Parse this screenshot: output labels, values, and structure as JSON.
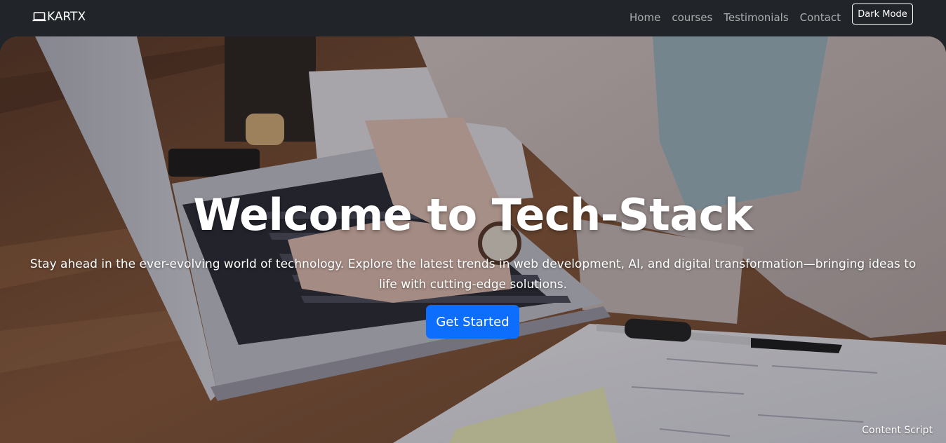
{
  "navbar": {
    "brand": "KARTX",
    "brand_icon": "laptop-icon",
    "links": [
      "Home",
      "courses",
      "Testimonials",
      "Contact"
    ],
    "dark_mode_label": "Dark Mode"
  },
  "hero": {
    "title": "Welcome to Tech-Stack",
    "subtitle": "Stay ahead in the ever-evolving world of technology. Explore the latest trends in web development, AI, and digital transformation—bringing ideas to life with cutting-edge solutions.",
    "cta_label": "Get Started",
    "background_image": "laptop-typing-photo"
  },
  "footer_badge": "Content Script",
  "colors": {
    "navbar_bg": "#212529",
    "primary": "#0d6efd",
    "text": "#ffffff"
  }
}
